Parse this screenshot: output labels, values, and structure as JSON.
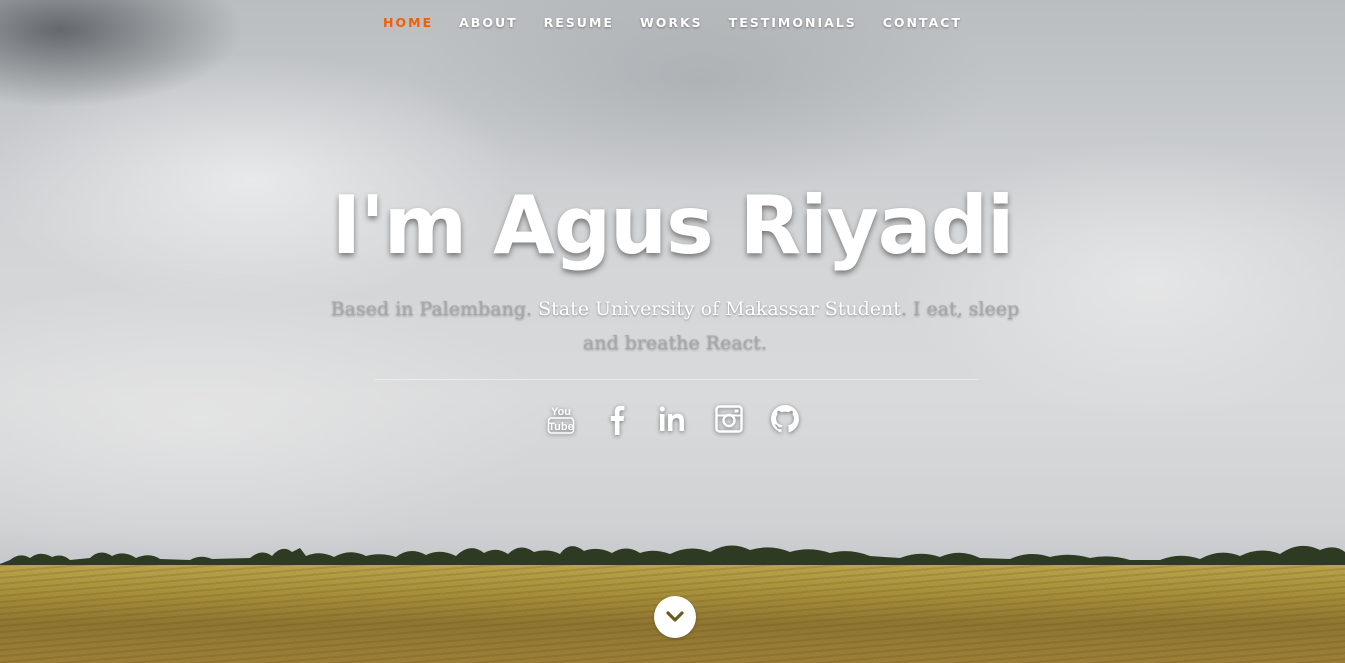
{
  "nav": {
    "items": [
      {
        "label": "HOME",
        "active": true
      },
      {
        "label": "ABOUT",
        "active": false
      },
      {
        "label": "RESUME",
        "active": false
      },
      {
        "label": "WORKS",
        "active": false
      },
      {
        "label": "TESTIMONIALS",
        "active": false
      },
      {
        "label": "CONTACT",
        "active": false
      }
    ],
    "active_color": "#f06000"
  },
  "hero": {
    "headline": "I'm Agus Riyadi",
    "tagline_part1": "Based in Palembang. ",
    "tagline_highlight": "State University of Makassar Student",
    "tagline_part2": ". I eat, sleep and breathe React.",
    "social_icons": [
      "youtube-icon",
      "facebook-icon",
      "linkedin-icon",
      "instagram-icon",
      "github-icon"
    ],
    "scroll_icon": "chevron-down-icon"
  }
}
